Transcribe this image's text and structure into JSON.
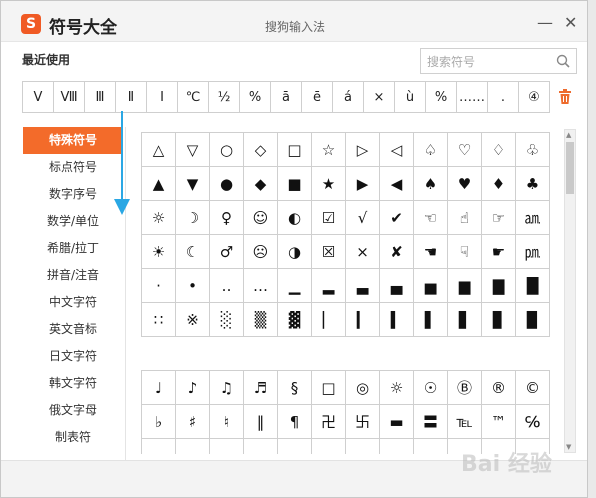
{
  "window": {
    "logo_letter": "S",
    "app_title": "符号大全",
    "ime_title": "搜狗输入法",
    "minimize_label": "—",
    "close_label": "✕"
  },
  "recent": {
    "label": "最近使用",
    "symbols": [
      "Ⅴ",
      "Ⅷ",
      "Ⅲ",
      "Ⅱ",
      "Ⅰ",
      "℃",
      "½",
      "%",
      "ā",
      "ē",
      "á",
      "×",
      "ù",
      "%",
      "……",
      ".",
      "④"
    ]
  },
  "search": {
    "placeholder": "搜索符号",
    "value": ""
  },
  "sidebar": {
    "items": [
      "特殊符号",
      "标点符号",
      "数字序号",
      "数学/单位",
      "希腊/拉丁",
      "拼音/注音",
      "中文字符",
      "英文音标",
      "日文字符",
      "韩文字符",
      "俄文字母",
      "制表符"
    ],
    "active_index": 0,
    "accent_color": "#f36b2a"
  },
  "grid_special": {
    "cells": [
      "△",
      "▽",
      "○",
      "◇",
      "□",
      "☆",
      "▷",
      "◁",
      "♤",
      "♡",
      "♢",
      "♧",
      "▲",
      "▼",
      "●",
      "◆",
      "■",
      "★",
      "▶",
      "◀",
      "♠",
      "♥",
      "♦",
      "♣",
      "☼",
      "☽",
      "♀",
      "☺",
      "◐",
      "☑",
      "√",
      "✔",
      "☜",
      "☝",
      "☞",
      "㏂",
      "☀",
      "☾",
      "♂",
      "☹",
      "◑",
      "☒",
      "×",
      "✘",
      "☚",
      "☟",
      "☛",
      "㏘",
      "·",
      "•",
      "‥",
      "…",
      "▁",
      "▂",
      "▃",
      "▄",
      "▅",
      "▆",
      "▇",
      "█",
      "∷",
      "※",
      "░",
      "▒",
      "▓",
      "▏",
      "▎",
      "▍",
      "▌",
      "▋",
      "▊",
      "▉"
    ]
  },
  "grid_music": {
    "cells": [
      "♩",
      "♪",
      "♫",
      "♬",
      "§",
      "□",
      "◎",
      "☼",
      "☉",
      "Ⓑ",
      "®",
      "©",
      "♭",
      "♯",
      "♮",
      "‖",
      "¶",
      "卍",
      "卐",
      "▬",
      "〓",
      "℡",
      "™",
      "℅",
      "",
      "",
      "",
      "",
      "",
      "",
      "",
      "",
      "",
      "",
      "",
      ""
    ]
  },
  "watermark": "Bai 经验"
}
